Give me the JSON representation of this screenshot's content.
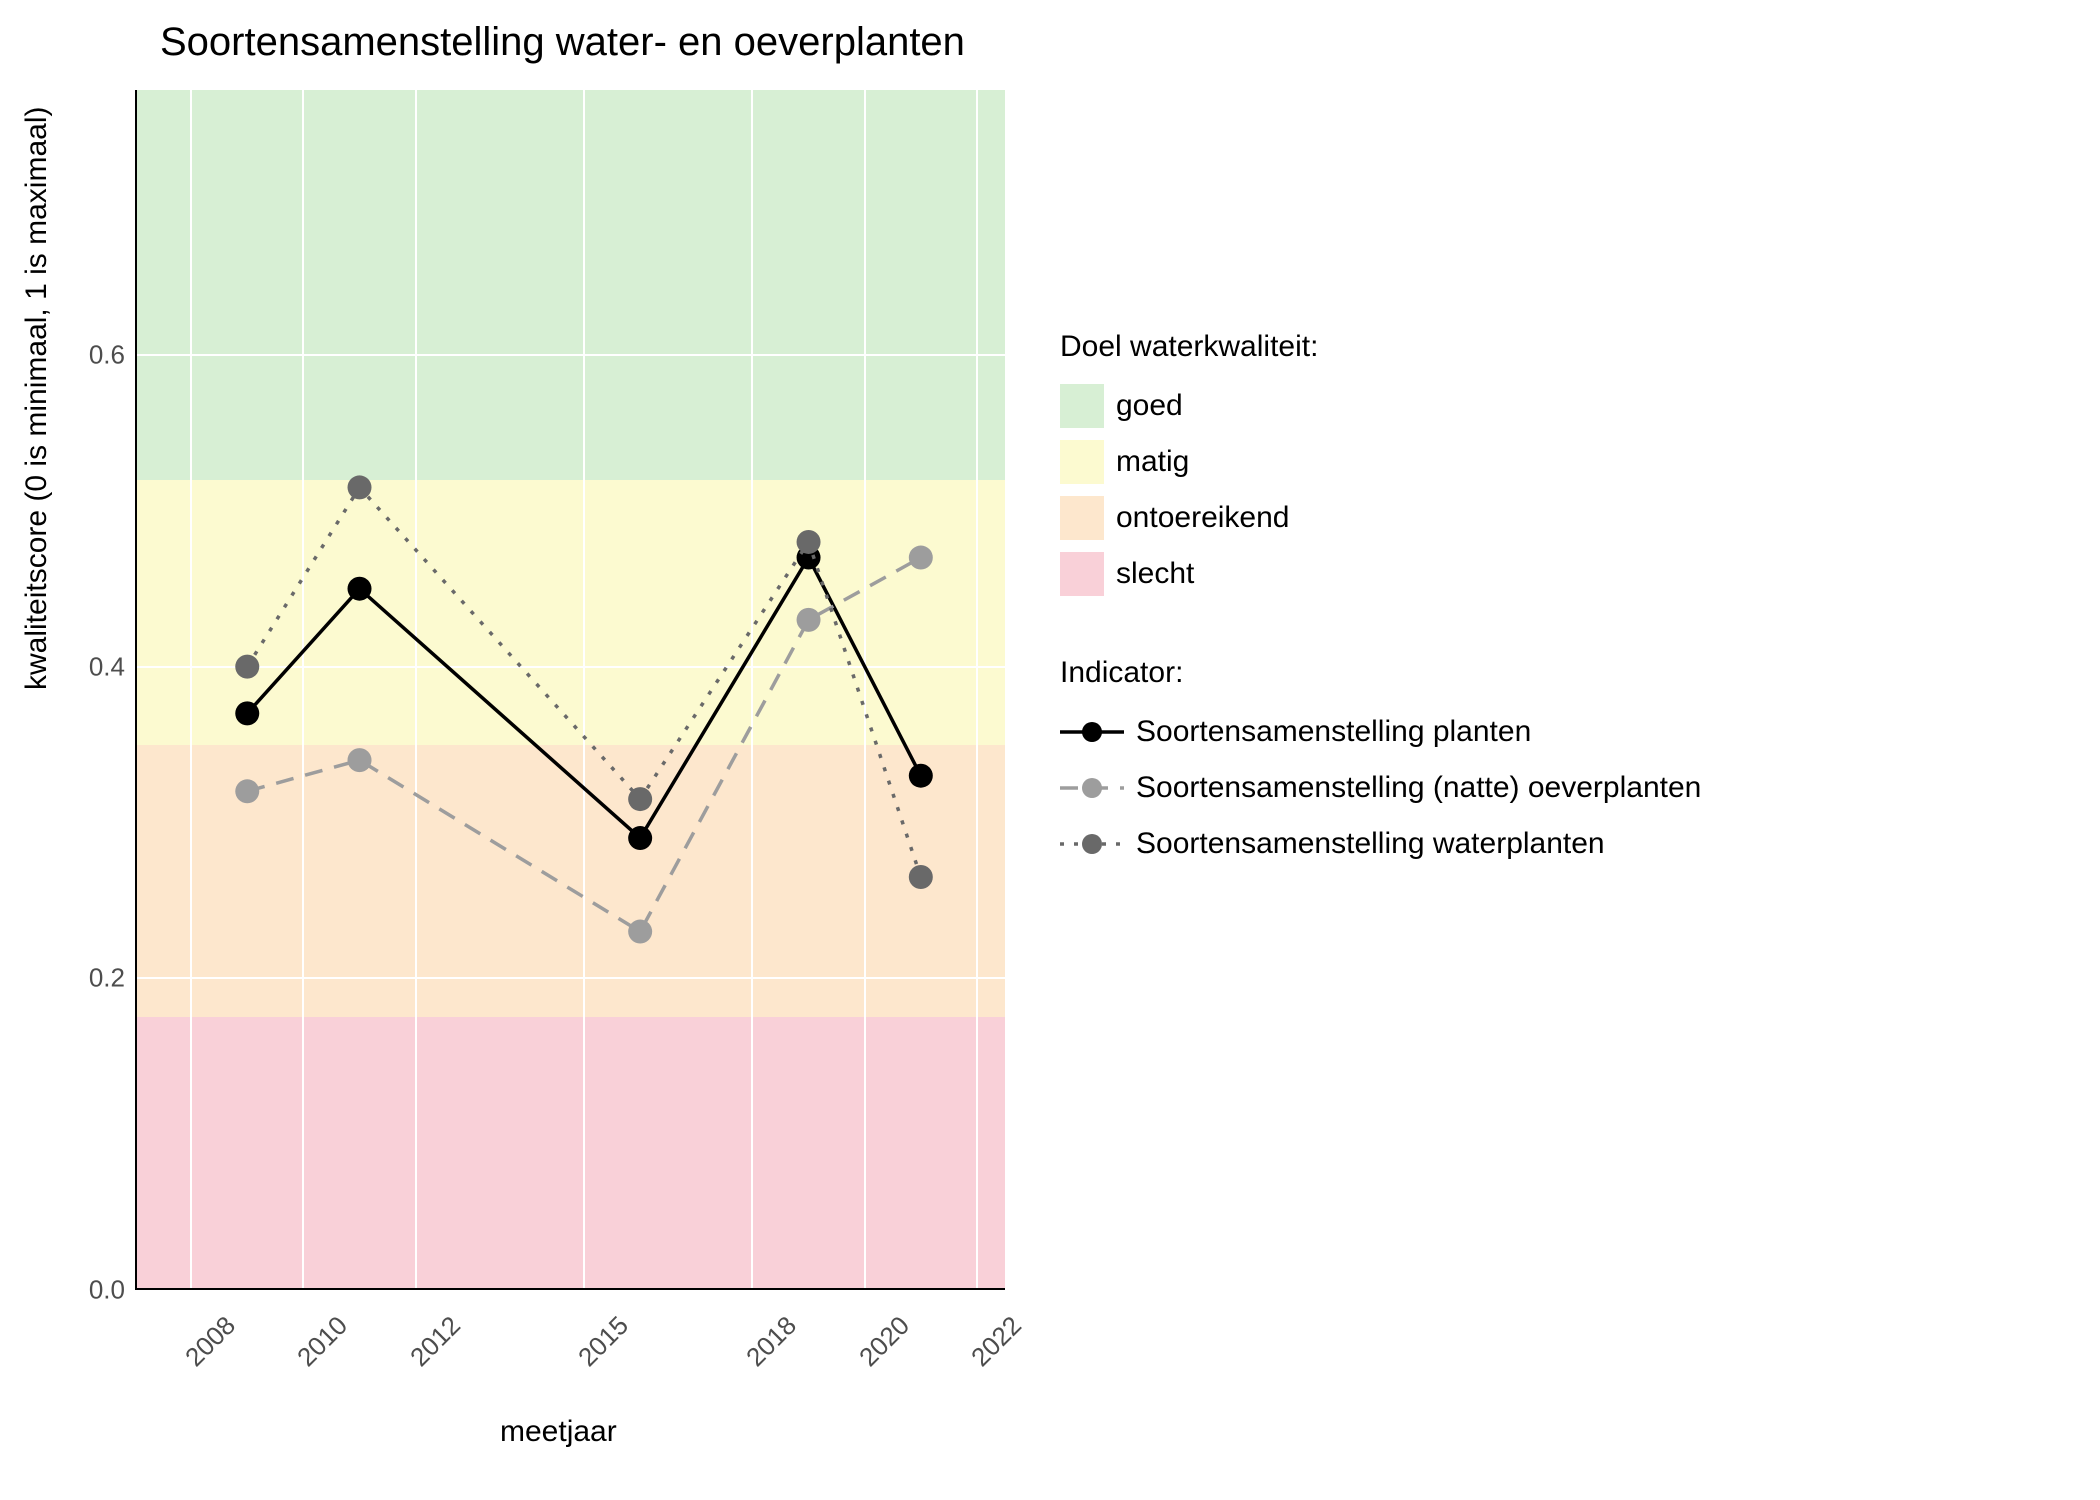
{
  "chart_data": {
    "type": "line",
    "title": "Soortensamenstelling water- en oeverplanten",
    "xlabel": "meetjaar",
    "ylabel": "kwaliteitscore (0 is minimaal, 1 is maximaal)",
    "ylim": [
      0.0,
      0.77
    ],
    "xlim": [
      2007,
      2022.5
    ],
    "x_ticks": [
      2008,
      2010,
      2012,
      2015,
      2018,
      2020,
      2022
    ],
    "y_ticks": [
      0.0,
      0.2,
      0.4,
      0.6
    ],
    "x": [
      2009,
      2011,
      2016,
      2019,
      2021
    ],
    "series": [
      {
        "name": "Soortensamenstelling planten",
        "values": [
          0.37,
          0.45,
          0.29,
          0.47,
          0.33
        ],
        "color": "#000000",
        "dash": "solid"
      },
      {
        "name": "Soortensamenstelling (natte) oeverplanten",
        "values": [
          0.32,
          0.34,
          0.23,
          0.43,
          0.47
        ],
        "color": "#9d9d9d",
        "dash": "dashed"
      },
      {
        "name": "Soortensamenstelling waterplanten",
        "values": [
          0.4,
          0.515,
          0.315,
          0.48,
          0.265
        ],
        "color": "#696969",
        "dash": "dotted"
      }
    ],
    "bands": [
      {
        "name": "goed",
        "from": 0.52,
        "to": 0.77,
        "color": "#d7efd4"
      },
      {
        "name": "matig",
        "from": 0.35,
        "to": 0.52,
        "color": "#fcfad0"
      },
      {
        "name": "ontoereikend",
        "from": 0.175,
        "to": 0.35,
        "color": "#fde7cd"
      },
      {
        "name": "slecht",
        "from": 0.0,
        "to": 0.175,
        "color": "#f9d0d8"
      }
    ],
    "legend_band_title": "Doel waterkwaliteit:",
    "legend_series_title": "Indicator:"
  }
}
